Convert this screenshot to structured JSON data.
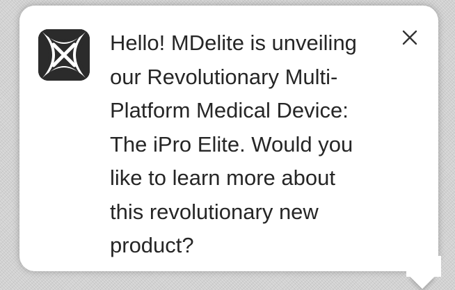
{
  "notification": {
    "message": "Hello! MDelite is unveiling\nour Revolutionary Multi-\nPlatform Medical Device:\nThe iPro Elite. Would you\nlike to learn more about\nthis revolutionary new\nproduct?",
    "logo_icon": "mdelite-logo-icon",
    "close_icon": "close-icon"
  },
  "colors": {
    "bubble": "#ffffff",
    "text": "#262626",
    "logo_dark": "#2b2b2b",
    "close": "#333333"
  }
}
